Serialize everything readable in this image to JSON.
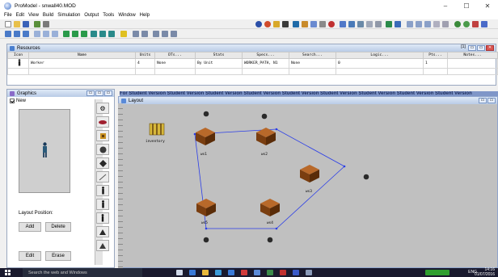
{
  "window": {
    "title": "ProModel - snwall40.MOD",
    "min": "–",
    "max": "☐",
    "close": "✕"
  },
  "menu": [
    "File",
    "Edit",
    "View",
    "Build",
    "Simulation",
    "Output",
    "Tools",
    "Window",
    "Help"
  ],
  "resources": {
    "title": "Resources",
    "controls": [
      "[1]",
      "▭",
      "▭",
      "✕"
    ],
    "columns": [
      "Icon",
      "Name",
      "Units",
      "DTs...",
      "Stats",
      "Specs...",
      "Search...",
      "Logic...",
      "Pts...",
      "Notes..."
    ],
    "rows": [
      {
        "icon": "worker-icon",
        "name": "Worker",
        "units": "4",
        "dts": "None",
        "stats": "By Unit",
        "specs": "WORKER_PATH, N1",
        "search": "None",
        "logic": "0",
        "pts": "1",
        "notes": ""
      }
    ]
  },
  "graphics": {
    "title": "Graphics",
    "new_label": "New",
    "edit_button": "Edit",
    "erase_button": "Erase",
    "layout_position_label": "Layout Position:",
    "add_button": "Add",
    "delete_button": "Delete"
  },
  "layout": {
    "title": "Layout",
    "header_text": "For Student Version Student Version Student Version Student Version Student Version Student Version Student Version Student Version Student Version",
    "locations": [
      {
        "name": "inventory"
      },
      {
        "name": "ws1"
      },
      {
        "name": "ws2"
      },
      {
        "name": "ws3"
      },
      {
        "name": "ws4"
      },
      {
        "name": "ws5"
      }
    ]
  },
  "taskbar": {
    "search_placeholder": "Search the web and Windows",
    "language": "ENG",
    "time": "14:16",
    "date": "01/07/2016"
  },
  "colors": {
    "layout_bg": "#c0c0c0",
    "path": "#2a3de8",
    "desk": "#8b4a14"
  }
}
